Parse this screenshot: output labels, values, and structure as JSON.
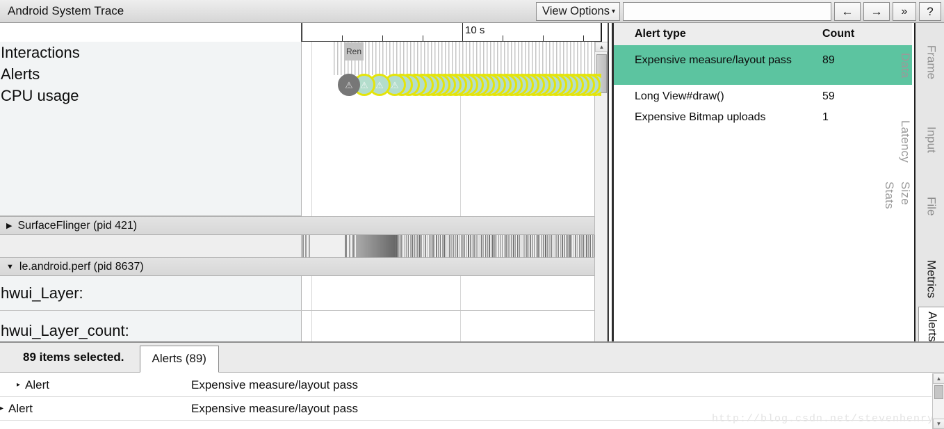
{
  "titlebar": {
    "app_title": "Android System Trace",
    "view_options_label": "View Options",
    "view_options_caret": "▾",
    "search_value": "",
    "search_placeholder": "",
    "prev_icon": "←",
    "next_icon": "→",
    "overflow_icon": "»",
    "help_icon": "?"
  },
  "timeline": {
    "ruler": {
      "label": "10 s",
      "major_tick_positions_pct": [
        0,
        53.5
      ],
      "minor_tick_positions_pct": [
        13.4,
        26.8,
        40.2,
        67.0,
        80.4,
        93.8
      ]
    },
    "overview_tracks": [
      {
        "label": "Interactions"
      },
      {
        "label": "Alerts"
      },
      {
        "label": "CPU usage"
      }
    ],
    "frame_chip_label": "Ren",
    "alert_marker_icon": "⚠",
    "alert_marker_count": 42,
    "alert_marker_ring_color": "#e4e40b",
    "alert_marker_fill_color": "#b3ddcc",
    "alert_marker_first_color": "#777777",
    "groups": [
      {
        "label": "SurfaceFlinger (pid 421)",
        "expanded": false,
        "twisty": "▶"
      },
      {
        "label": "le.android.perf (pid 8637)",
        "expanded": true,
        "twisty": "▼"
      }
    ],
    "process_tracks": [
      {
        "label": "hwui_Layer:"
      },
      {
        "label": "hwui_Layer_count:"
      }
    ],
    "scroll_up_icon": "▲",
    "scroll_down_icon": "▼"
  },
  "alerts_table": {
    "columns": [
      "Alert type",
      "Count"
    ],
    "rows": [
      {
        "type": "Expensive measure/layout pass",
        "count": "89",
        "selected": true
      },
      {
        "type": "Long View#draw()",
        "count": "59",
        "selected": false
      },
      {
        "type": "Expensive Bitmap uploads",
        "count": "1",
        "selected": false
      }
    ],
    "selection_color": "#5cc4a0",
    "ghost_tabs": [
      "Data",
      "Latency",
      "Size",
      "Stats"
    ]
  },
  "side_tabs": {
    "items": [
      {
        "label": "Frame",
        "state": "inactive"
      },
      {
        "label": "Input",
        "state": "inactive"
      },
      {
        "label": "File",
        "state": "inactive"
      },
      {
        "label": "Metrics",
        "state": "enabled"
      },
      {
        "label": "Alerts",
        "state": "active"
      }
    ]
  },
  "bottom_panel": {
    "selection_summary": "89 items selected.",
    "tab_label": "Alerts (89)",
    "rows": [
      {
        "twisty": "▸",
        "kind": "Alert",
        "description": "Expensive measure/layout pass"
      },
      {
        "twisty": "▸",
        "kind": "Alert",
        "description": "Expensive measure/layout pass"
      }
    ],
    "scroll_up_icon": "▲",
    "scroll_down_icon": "▼",
    "watermark": "http://blog.csdn.net/stevenhenry"
  }
}
